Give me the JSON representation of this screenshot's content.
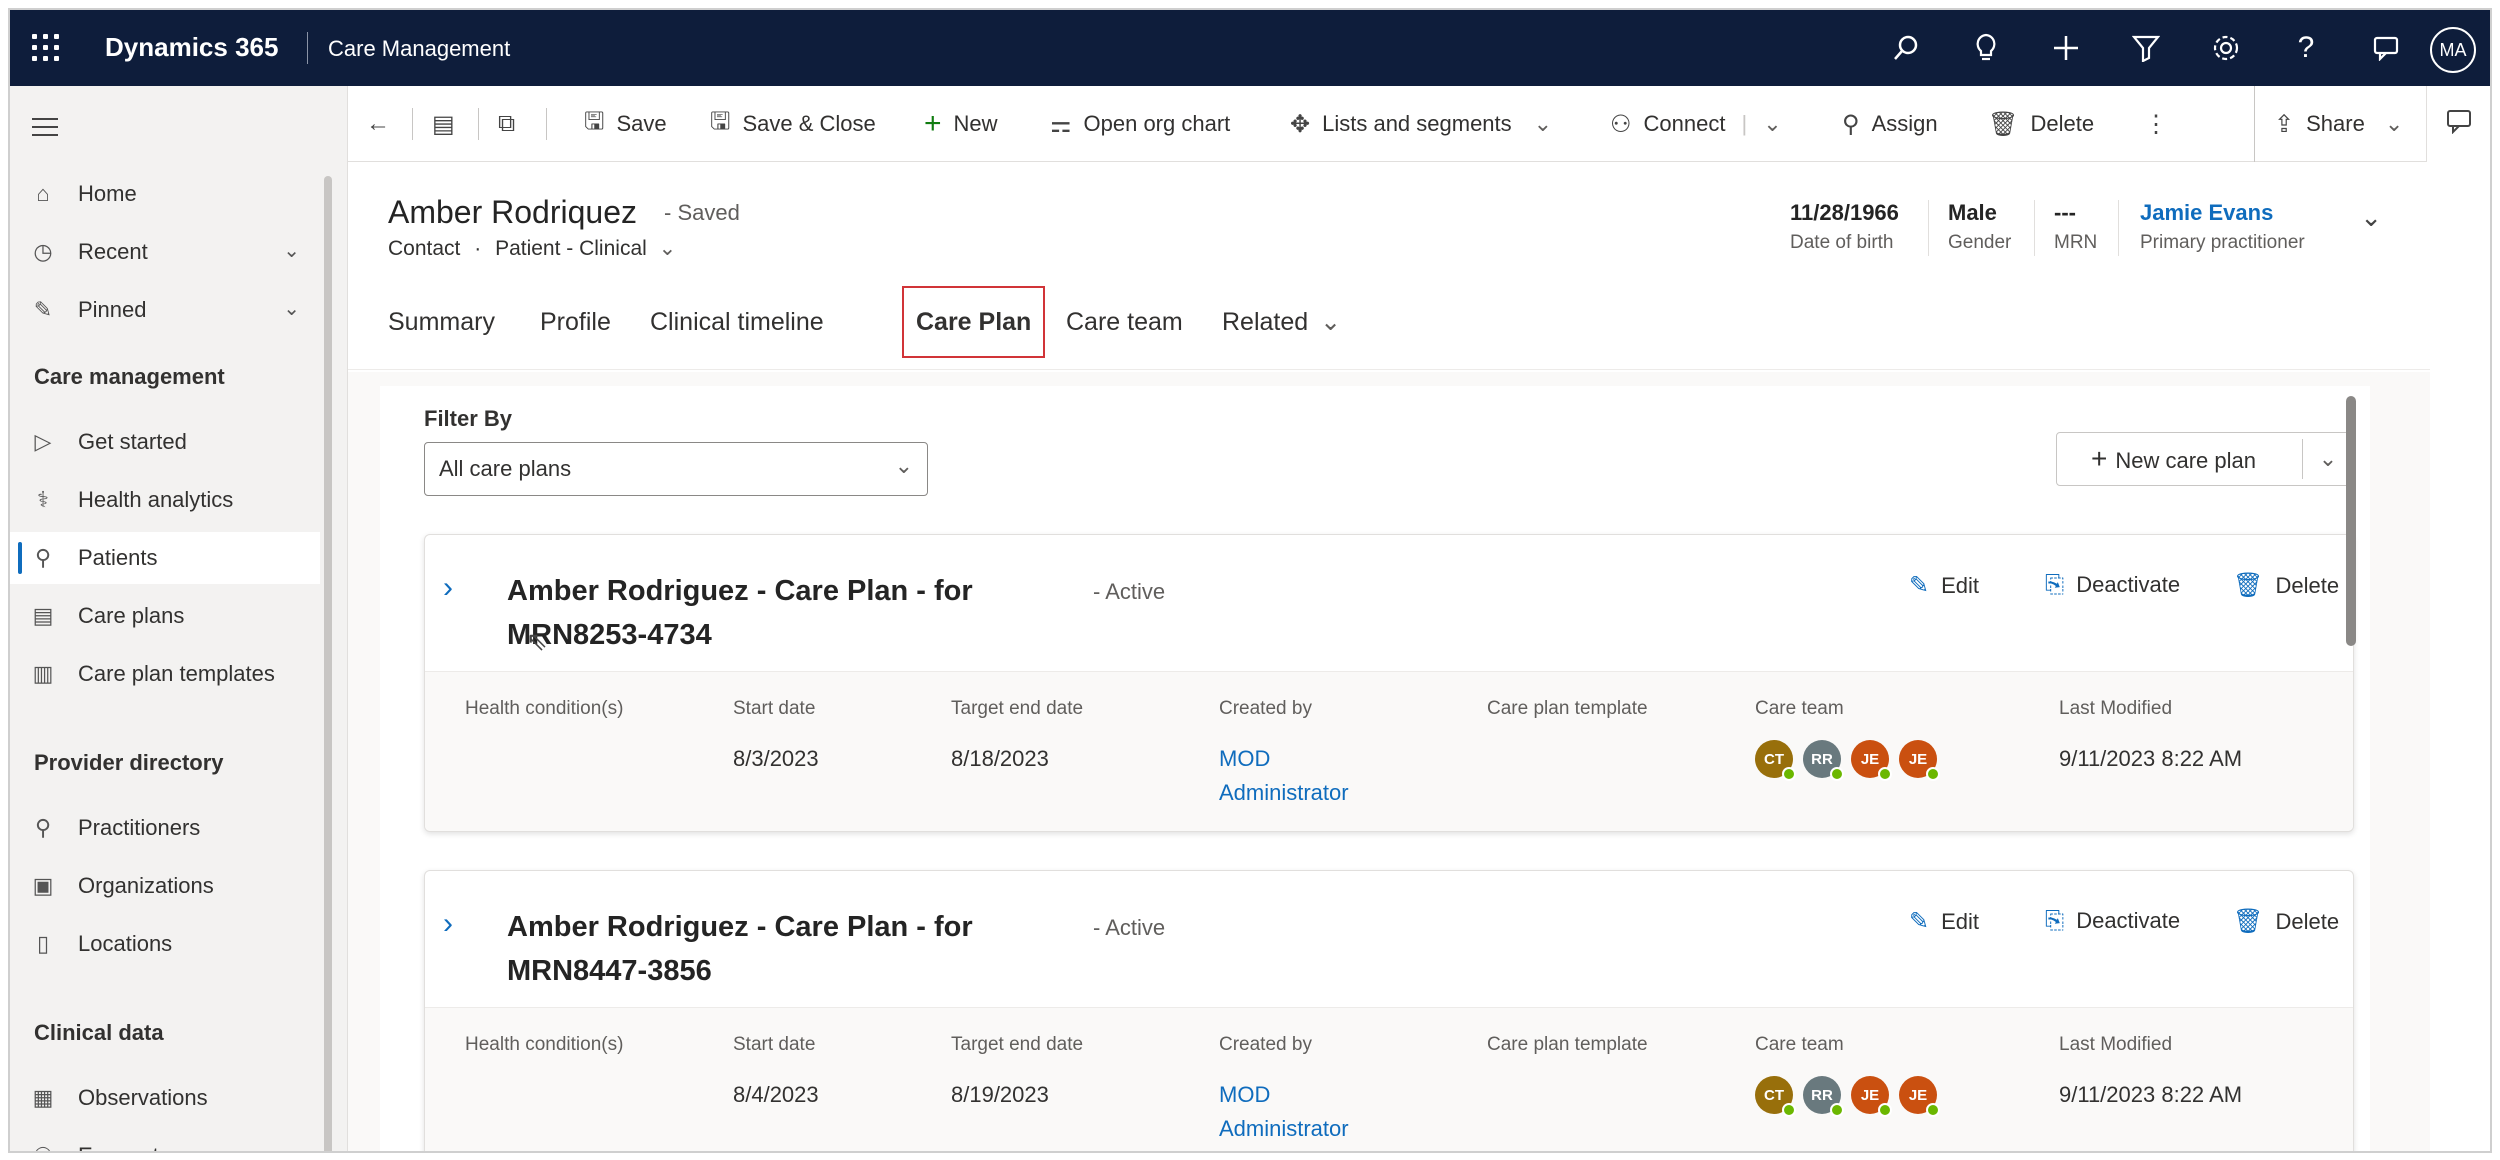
{
  "topbar": {
    "app_name": "Dynamics 365",
    "area": "Care Management",
    "user_initials": "MA",
    "icons": [
      "search-icon",
      "lightbulb-icon",
      "plus-icon",
      "filter-icon",
      "gear-icon",
      "help-icon",
      "chat-icon"
    ]
  },
  "nav": {
    "items": [
      {
        "label": "Home",
        "icon": "home-icon"
      },
      {
        "label": "Recent",
        "icon": "clock-icon",
        "chevron": true
      },
      {
        "label": "Pinned",
        "icon": "pin-icon",
        "chevron": true
      }
    ],
    "groups": [
      {
        "title": "Care management",
        "items": [
          {
            "label": "Get started",
            "icon": "play-icon"
          },
          {
            "label": "Health analytics",
            "icon": "analytics-icon"
          },
          {
            "label": "Patients",
            "icon": "person-icon",
            "active": true
          },
          {
            "label": "Care plans",
            "icon": "careplan-icon"
          },
          {
            "label": "Care plan templates",
            "icon": "template-icon"
          }
        ]
      },
      {
        "title": "Provider directory",
        "items": [
          {
            "label": "Practitioners",
            "icon": "practitioner-icon"
          },
          {
            "label": "Organizations",
            "icon": "organization-icon"
          },
          {
            "label": "Locations",
            "icon": "building-icon"
          }
        ]
      },
      {
        "title": "Clinical data",
        "items": [
          {
            "label": "Observations",
            "icon": "observation-icon"
          },
          {
            "label": "Encounters",
            "icon": "encounter-icon"
          }
        ]
      }
    ]
  },
  "commands": {
    "save": "Save",
    "save_close": "Save & Close",
    "new": "New",
    "org_chart": "Open org chart",
    "lists": "Lists and segments",
    "connect": "Connect",
    "assign": "Assign",
    "delete": "Delete",
    "share": "Share"
  },
  "record": {
    "name": "Amber Rodriquez",
    "saved": "- Saved",
    "entity": "Contact",
    "form": "Patient - Clinical",
    "fields": [
      {
        "value": "11/28/1966",
        "label": "Date of birth"
      },
      {
        "value": "Male",
        "label": "Gender"
      },
      {
        "value": "---",
        "label": "MRN"
      },
      {
        "value": "Jamie Evans",
        "label": "Primary practitioner"
      }
    ]
  },
  "tabs": [
    "Summary",
    "Profile",
    "Clinical timeline",
    "Care Plan",
    "Care team",
    "Related"
  ],
  "filter": {
    "label": "Filter By",
    "value": "All care plans",
    "new_button": "New care plan"
  },
  "columns": [
    "Health condition(s)",
    "Start date",
    "Target end date",
    "Created by",
    "Care plan template",
    "Care team",
    "Last Modified"
  ],
  "card_actions": {
    "edit": "Edit",
    "deactivate": "Deactivate",
    "delete": "Delete"
  },
  "care_plans": [
    {
      "title": "Amber Rodriguez - Care Plan - for MRN8253-4734",
      "status": "- Active",
      "start": "8/3/2023",
      "end": "8/18/2023",
      "created_by_1": "MOD",
      "created_by_2": "Administrator",
      "last_modified": "9/11/2023 8:22 AM",
      "team": [
        {
          "initials": "CT",
          "color": "#986f0b"
        },
        {
          "initials": "RR",
          "color": "#69797e"
        },
        {
          "initials": "JE",
          "color": "#ca5010"
        },
        {
          "initials": "JE",
          "color": "#ca5010"
        }
      ]
    },
    {
      "title": "Amber Rodriguez - Care Plan - for MRN8447-3856",
      "status": "- Active",
      "start": "8/4/2023",
      "end": "8/19/2023",
      "created_by_1": "MOD",
      "created_by_2": "Administrator",
      "last_modified": "9/11/2023 8:22 AM",
      "team": [
        {
          "initials": "CT",
          "color": "#986f0b"
        },
        {
          "initials": "RR",
          "color": "#69797e"
        },
        {
          "initials": "JE",
          "color": "#ca5010"
        },
        {
          "initials": "JE",
          "color": "#ca5010"
        }
      ]
    }
  ]
}
